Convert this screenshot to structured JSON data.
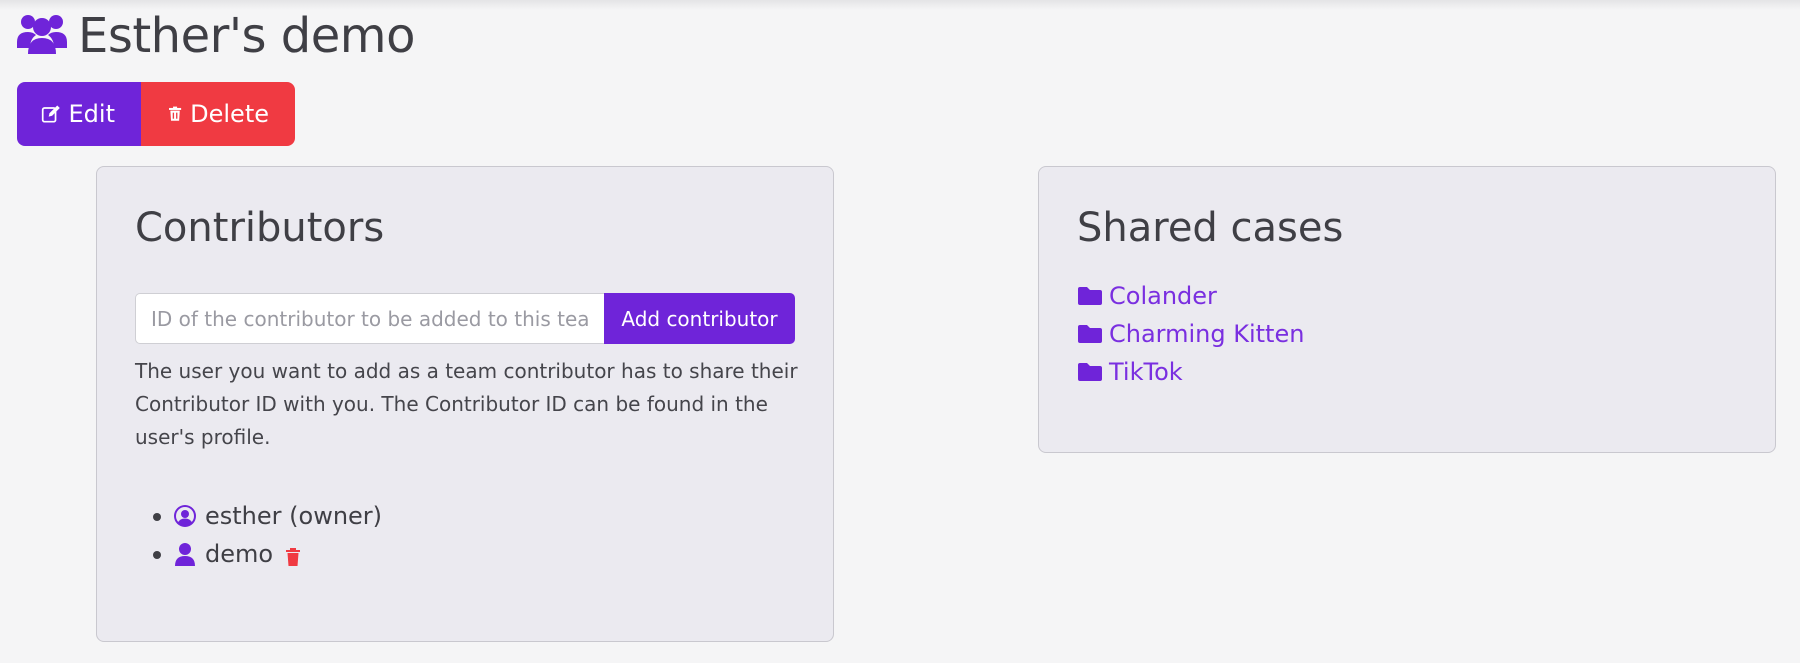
{
  "page": {
    "title": "Esther's demo"
  },
  "actions": {
    "edit_label": "Edit",
    "delete_label": "Delete"
  },
  "contributors": {
    "heading": "Contributors",
    "input_placeholder": "ID of the contributor to be added to this tea",
    "add_button": "Add contributor",
    "help_text": "The user you want to add as a team contributor has to share their Contributor ID with you. The Contributor ID can be found in the user's profile.",
    "items": [
      {
        "name": "esther (owner)",
        "icon": "user-circle-icon"
      },
      {
        "name": "demo",
        "icon": "user-icon",
        "removable": true
      }
    ]
  },
  "shared_cases": {
    "heading": "Shared cases",
    "items": [
      {
        "name": "Colander",
        "icon": "folder-icon"
      },
      {
        "name": "Charming Kitten",
        "icon": "folder-icon"
      },
      {
        "name": "TikTok",
        "icon": "folder-icon"
      }
    ]
  },
  "colors": {
    "accent": "#6f24d9",
    "danger": "#f03a42",
    "link": "#7a2fe0",
    "card_bg": "#ebeaf0",
    "page_bg": "#f5f5f6"
  }
}
